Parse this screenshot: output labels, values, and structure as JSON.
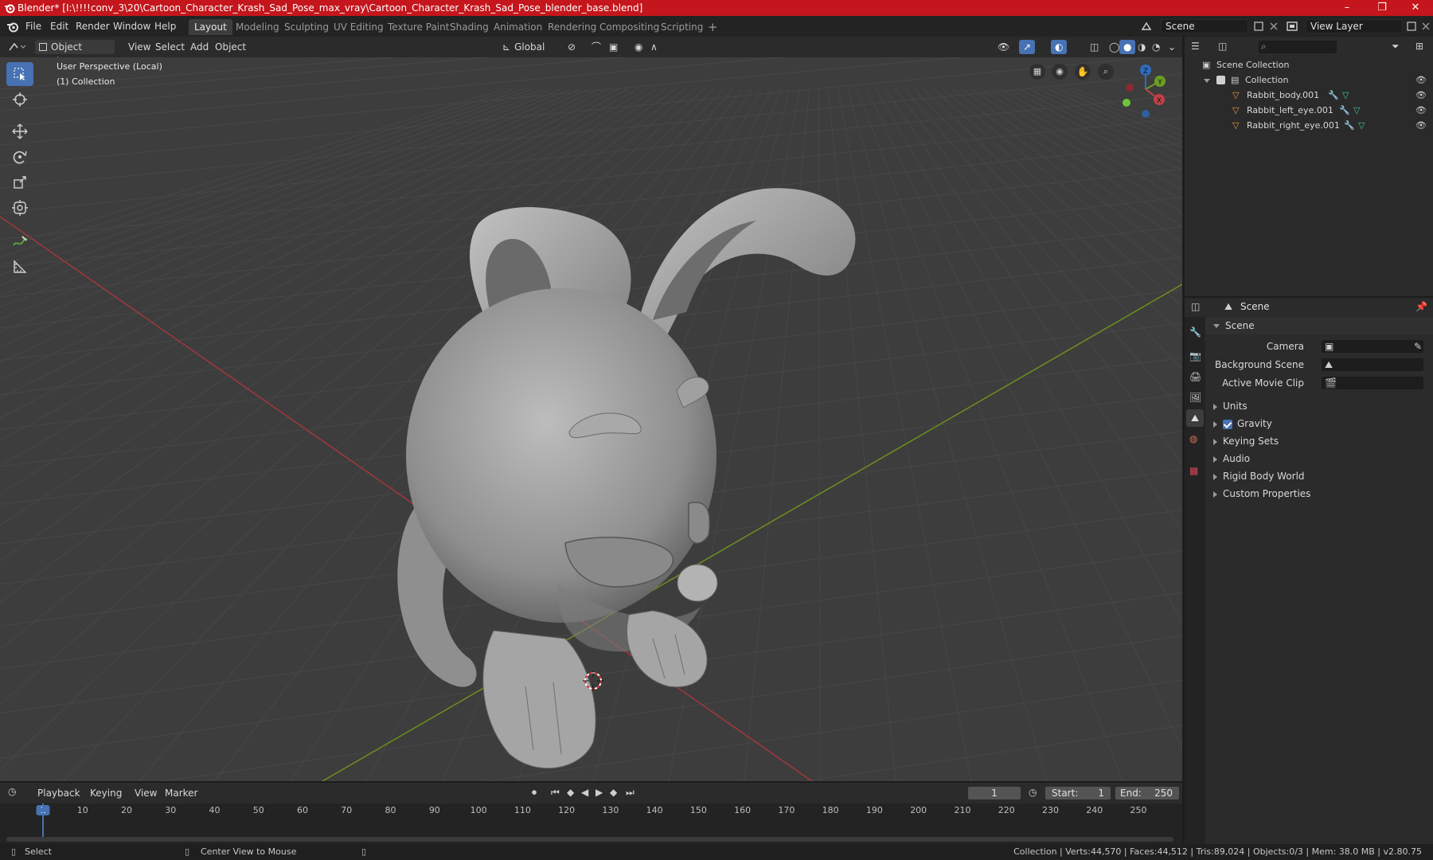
{
  "window": {
    "title": "Blender* [I:\\!!!!conv_3\\20\\Cartoon_Character_Krash_Sad_Pose_max_vray\\Cartoon_Character_Krash_Sad_Pose_blender_base.blend]",
    "controls": [
      "–",
      "❐",
      "✕"
    ]
  },
  "menu": [
    "File",
    "Edit",
    "Render",
    "Window",
    "Help"
  ],
  "workspaces": [
    "Layout",
    "Modeling",
    "Sculpting",
    "UV Editing",
    "Texture Paint",
    "Shading",
    "Animation",
    "Rendering",
    "Compositing",
    "Scripting"
  ],
  "workspace_add": "+",
  "active_workspace": "Layout",
  "scene_field": "Scene",
  "view_layer_field": "View Layer",
  "viewport_header": {
    "mode": "Object Mode",
    "menus": [
      "View",
      "Select",
      "Add",
      "Object"
    ],
    "orientation": "Global"
  },
  "viewport": {
    "perspective_label": "User Perspective (Local)",
    "collection_label": "(1) Collection",
    "gizmo": {
      "x": "X",
      "y": "Y",
      "z": "Z"
    },
    "colors": {
      "x_axis": "#a0383d",
      "y_axis": "#6b8f1e",
      "z_axis": "#2f6cbf",
      "grid": "#474747"
    }
  },
  "outliner": {
    "root": "Scene Collection",
    "collection": "Collection",
    "objects": [
      "Rabbit_body.001",
      "Rabbit_left_eye.001",
      "Rabbit_right_eye.001"
    ]
  },
  "properties": {
    "header": "Scene",
    "panel": "Scene",
    "fields": [
      {
        "label": "Camera",
        "value": ""
      },
      {
        "label": "Background Scene",
        "value": ""
      },
      {
        "label": "Active Movie Clip",
        "value": ""
      }
    ],
    "sections": [
      "Units",
      "Gravity",
      "Keying Sets",
      "Audio",
      "Rigid Body World",
      "Custom Properties"
    ],
    "gravity_checked": true
  },
  "timeline": {
    "menus": [
      "Playback",
      "Keying",
      "View",
      "Marker"
    ],
    "current_frame": "1",
    "start_label": "Start:",
    "start": "1",
    "end_label": "End:",
    "end": "250",
    "ticks": [
      1,
      10,
      20,
      30,
      40,
      50,
      60,
      70,
      80,
      90,
      100,
      110,
      120,
      130,
      140,
      150,
      160,
      170,
      180,
      190,
      200,
      210,
      220,
      230,
      240,
      250
    ]
  },
  "statusbar": {
    "select": "Select",
    "center": "Center View to Mouse",
    "stats": "Collection | Verts:44,570 | Faces:44,512 | Tris:89,024 | Objects:0/3 | Mem: 38.0 MB | v2.80.75"
  }
}
